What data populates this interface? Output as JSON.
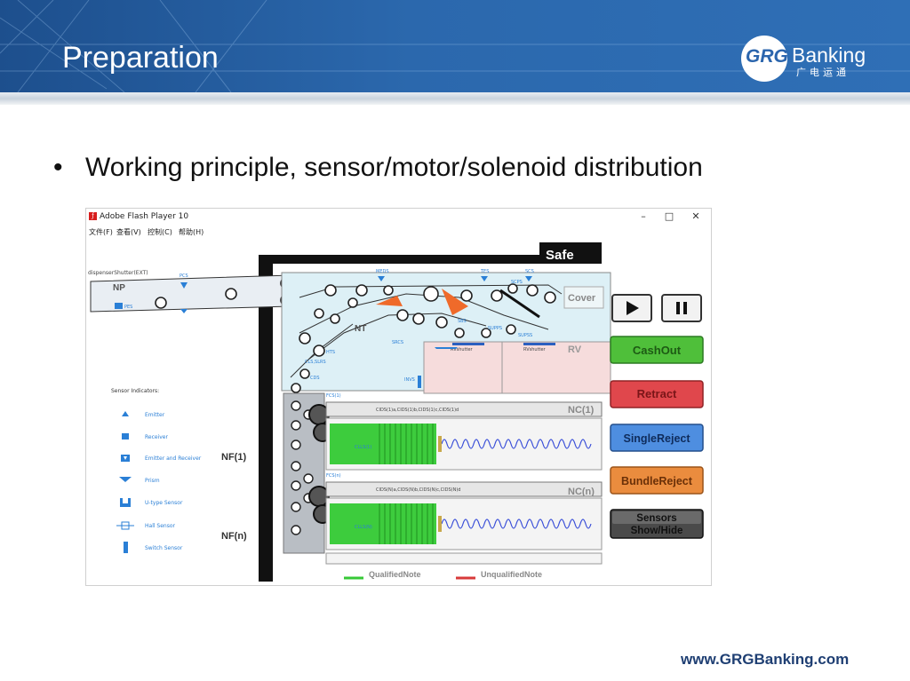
{
  "slide": {
    "title": "Preparation",
    "bullet": "Working principle, sensor/motor/solenoid distribution",
    "footer_url": "www.GRGBanking.com"
  },
  "logo": {
    "mark": "GRG",
    "name": "Banking",
    "subtitle": "广电运通",
    "brand_color": "#2b65ad"
  },
  "window": {
    "title": "Adobe Flash Player 10",
    "menu": [
      "文件(F)",
      "查看(V)",
      "控制(C)",
      "帮助(H)"
    ],
    "controls": {
      "minimize": "–",
      "maximize": "□",
      "close": "✕"
    }
  },
  "simulation": {
    "safe_label": "Safe",
    "cover_label": "Cover",
    "np_label": "NP",
    "nt_label": "NT",
    "rv_label": "RV",
    "nc1_label": "NC(1)",
    "ncn_label": "NC(n)",
    "nf1_label": "NF(1)",
    "nfn_label": "NF(n)",
    "dispenser_shutter_label": "dispenserShutter(EXT)",
    "pes_label": "PES",
    "sensor_labels": {
      "pcs": "PCS",
      "meds": "MEDS",
      "tes": "TES",
      "scs": "SCS",
      "scps": "SCPS",
      "sbs": "SBS",
      "sbf": "SBF",
      "supps": "SUPPS",
      "supss": "SUPSS",
      "src": "SRCS",
      "hts": "HTS",
      "clsr": "CLS,SLRS",
      "cds": "CDS",
      "invs": "INVS",
      "fcs1": "FCS(1)",
      "fcsn": "FCS(n)",
      "cids1": "CIDS(1)a,CIDS(1)b,CIDS(1)c,CIDS(1)d",
      "cidsn": "CIDS(N)a,CIDS(N)b,CIDS(N)c,CIDS(N)d",
      "cll1": "CLLS(1)",
      "clln": "CLLS(N)",
      "rv_shutter1": "RVshutter",
      "rv_shutter2": "RVshutter"
    },
    "legend_title": "Sensor  Indicators:",
    "legend_items": [
      {
        "icon": "emitter-icon",
        "label": "Emitter"
      },
      {
        "icon": "receiver-icon",
        "label": "Receiver"
      },
      {
        "icon": "emitter-receiver-icon",
        "label": "Emitter and Receiver"
      },
      {
        "icon": "prism-icon",
        "label": "Prism"
      },
      {
        "icon": "u-type-sensor-icon",
        "label": "U-type Sensor"
      },
      {
        "icon": "hall-sensor-icon",
        "label": "Hall Sensor"
      },
      {
        "icon": "switch-sensor-icon",
        "label": "Switch Sensor"
      }
    ],
    "note_legend": {
      "qualified": "QualifiedNote",
      "unqualified": "UnqualifiedNote",
      "qualified_color": "#37c837",
      "unqualified_color": "#d83a3a"
    },
    "buttons": {
      "play": "play-icon",
      "pause": "pause-icon",
      "cashout": "CashOut",
      "retract": "Retract",
      "single_reject": "SingleReject",
      "bundle_reject": "BundleReject",
      "sensors_line1": "Sensors",
      "sensors_line2": "Show/Hide"
    },
    "colors": {
      "cashout": "#4fbf3a",
      "retract": "#e0474c",
      "single_reject": "#4e8ee0",
      "bundle_reject": "#ea8c3e",
      "sensors": "#4a4a4a",
      "transport_bg": "#ddf0f6",
      "rv_bg": "#f6dcdc",
      "cassette_green": "#3dcc3d",
      "sensor_blue": "#2a7fd6",
      "solenoid_orange": "#ef6a2a"
    }
  }
}
